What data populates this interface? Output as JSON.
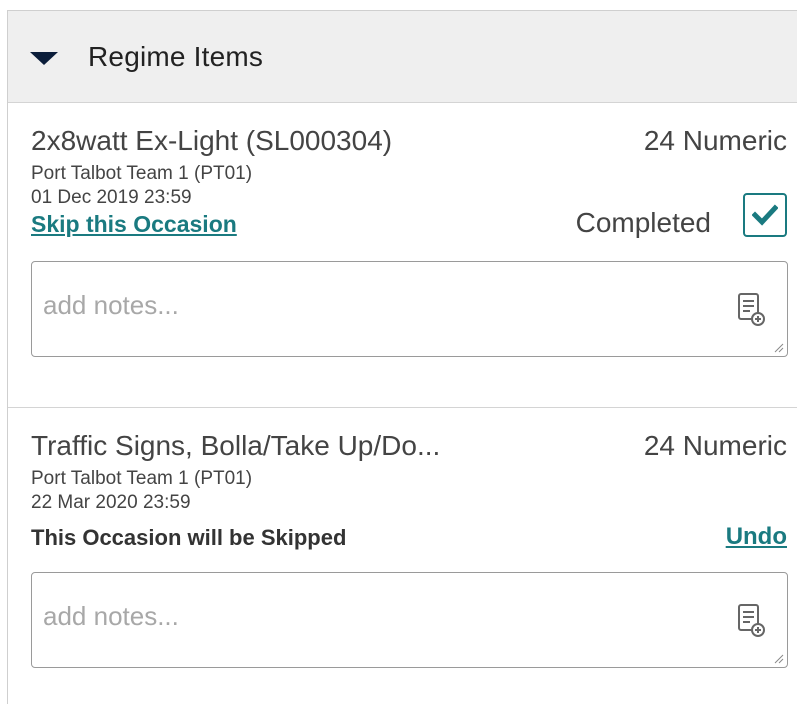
{
  "header": {
    "title": "Regime Items"
  },
  "items": [
    {
      "name": "2x8watt Ex-Light (SL000304)",
      "type": "24 Numeric",
      "team": "Port Talbot Team 1 (PT01)",
      "date": "01 Dec 2019 23:59",
      "skip_link": "Skip this Occasion",
      "status": "Completed",
      "completed": true,
      "notes_placeholder": "add notes...",
      "notes_value": ""
    },
    {
      "name": "Traffic Signs, Bolla/Take Up/Do...",
      "type": "24 Numeric",
      "team": "Port Talbot Team 1 (PT01)",
      "date": "22 Mar 2020 23:59",
      "skipped_message": "This Occasion will be Skipped",
      "undo_link": "Undo",
      "notes_placeholder": "add notes...",
      "notes_value": ""
    }
  ],
  "colors": {
    "accent": "#1a7a80",
    "header_bg": "#efefef",
    "caret": "#0b1d3a"
  },
  "icons": {
    "collapse": "caret-down-icon",
    "checkbox": "checkmark-icon",
    "add_note": "add-note-icon",
    "resize": "resize-grip-icon"
  }
}
